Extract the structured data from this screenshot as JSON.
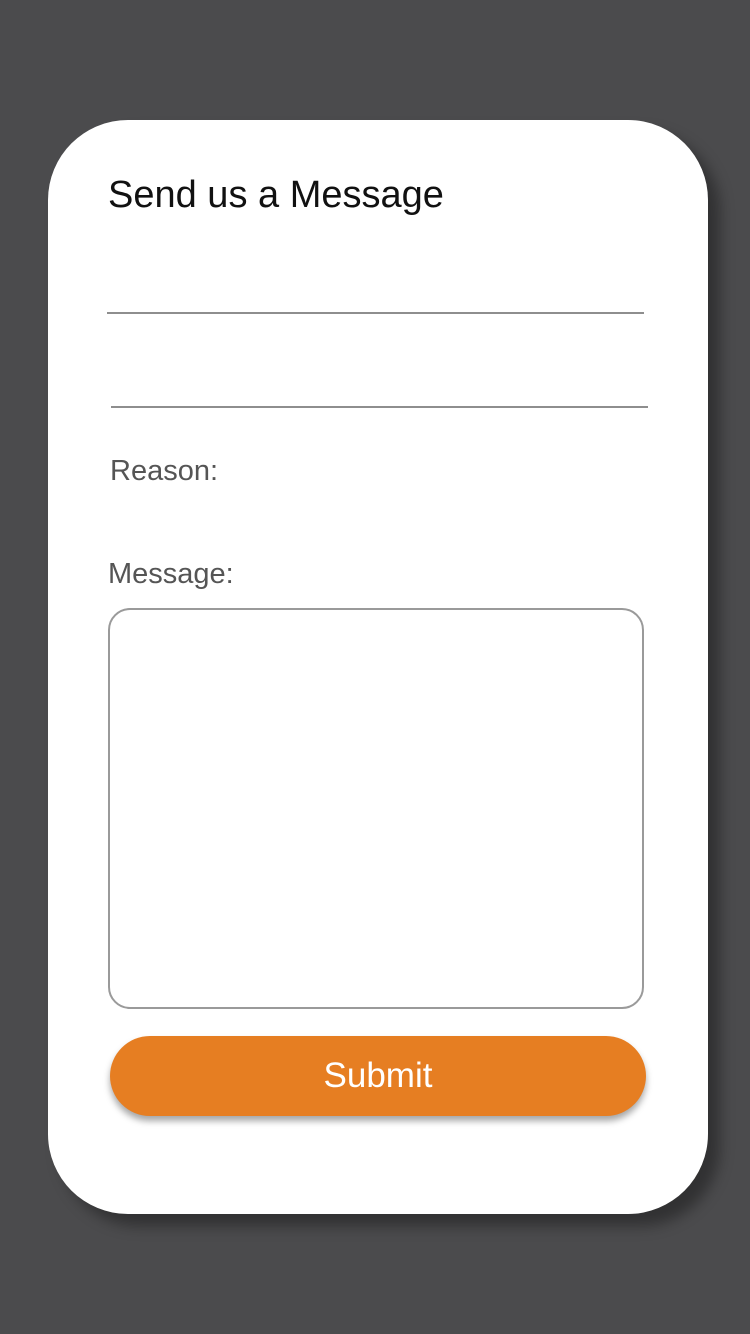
{
  "form": {
    "title": "Send us a Message",
    "name_field": {
      "value": "",
      "placeholder": ""
    },
    "email_field": {
      "value": "",
      "placeholder": ""
    },
    "reason_label": "Reason:",
    "reason_value": "",
    "message_label": "Message:",
    "message_field": {
      "value": "",
      "placeholder": ""
    },
    "submit_label": "Submit"
  },
  "colors": {
    "background": "#4b4b4d",
    "card": "#ffffff",
    "accent": "#e67e22",
    "divider": "#8e8e8e"
  }
}
